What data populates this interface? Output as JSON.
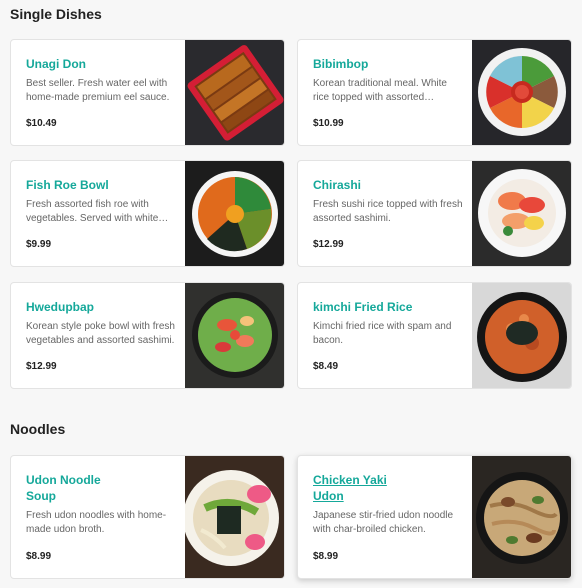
{
  "sections": [
    {
      "title": "Single Dishes",
      "items": [
        {
          "name": "Unagi Don",
          "description": "Best seller. Fresh water eel with home-made premium eel sauce.",
          "price": "$10.49"
        },
        {
          "name": "Bibimbop",
          "description": "Korean traditional meal. White rice topped with assorted vegetables.",
          "price": "$10.99"
        },
        {
          "name": "Fish Roe Bowl",
          "description": "Fresh assorted fish roe with vegetables. Served with white rice.",
          "price": "$9.99"
        },
        {
          "name": "Chirashi",
          "description": "Fresh sushi rice topped with fresh assorted sashimi.",
          "price": "$12.99"
        },
        {
          "name": "Hwedupbap",
          "description": "Korean style poke bowl with fresh vegetables and assorted sashimi.",
          "price": "$12.99"
        },
        {
          "name": "kimchi Fried Rice",
          "description": "Kimchi fried rice with spam and bacon.",
          "price": "$8.49"
        }
      ]
    },
    {
      "title": "Noodles",
      "items": [
        {
          "name": "Udon Noodle Soup",
          "description": "Fresh udon noodles with home-made udon broth.",
          "price": "$8.99"
        },
        {
          "name": "Chicken Yaki Udon",
          "description": "Japanese stir-fried udon noodle with char-broiled chicken.",
          "price": "$8.99"
        }
      ]
    }
  ]
}
